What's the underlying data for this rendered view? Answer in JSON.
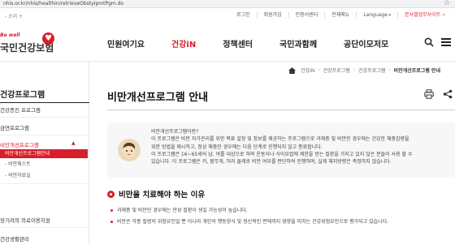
{
  "browser": {
    "url": "nhis.or.kr/nhis/healthin/retrieveObstyIpmtPgm.do"
  },
  "topbar": {
    "volume_label": "- 소리 +",
    "links": [
      "로그인",
      "회원가입",
      "인증서센터",
      "전체메뉴",
      "Language",
      "본사별업무사이트"
    ]
  },
  "logo": {
    "tagline": "Be well",
    "name": "국민건강보험"
  },
  "gnb": {
    "items": [
      "민원여기요",
      "건강iN",
      "정책센터",
      "국민과함께",
      "공단이모저모"
    ],
    "active_index": 1
  },
  "breadcrumb": [
    "건강iN",
    "건강프로그램",
    "건강프로그램",
    "비만개선프로그램 안내"
  ],
  "sidebar": {
    "title": "건강프로그램",
    "items": [
      {
        "label": "건강증진 프로그램",
        "open": false
      },
      {
        "label": "금연프로그램",
        "open": false
      },
      {
        "label": "비만개선프로그램",
        "open": true,
        "sub": [
          "비만개선프로그램안내",
          "비만체스트",
          "비만자료실"
        ],
        "current_sub": 0
      },
      {
        "label": "장기려의 의료이용지원",
        "open": false
      },
      {
        "label": "건강생활관리",
        "open": false
      }
    ]
  },
  "page": {
    "title": "비만개선프로그램 안내"
  },
  "intro": {
    "lines": [
      "비만개선프로그램이란?",
      "이 프로그램은 비만 자가관리를 위한 목표 설정 및 정보를 제공하는 프로그램으로 과체중 및 비만인 경우에는 건강한 체중감량을",
      "위한 방법을 제시하고, 정상 체중인 경우에는 다음 단계로 진행되지 않고 종료됩니다.",
      "이 프로그램은 16~65세의 남, 여를 대상으로 하며 운동이나 식이요법에 제한을 받는 질환을 가지고 있지 않은 분들이 사용 할 수",
      "있습니다. 이 프로그램은 키, 몸무게, 허리 둘레로 비만 여부를 판단하여 진행하며, 실제 체지방량은 측정하지 않습니다."
    ]
  },
  "section": {
    "title": "비만을 치료해야 하는 이유",
    "bullets": [
      "과체중 및 비만인 경우에는 만성 질환이 생길 가능성이 높습니다.",
      "비만은 각종 질병의 위험요인일 뿐 아니라 개인의 행동양식 및 정신적인 면에까지 영향을 미치는 건강위험요인으로 평가되고 있습니다."
    ]
  },
  "colors": {
    "brand": "#d81e2b",
    "text": "#222222",
    "panel": "#f7f7f7"
  }
}
